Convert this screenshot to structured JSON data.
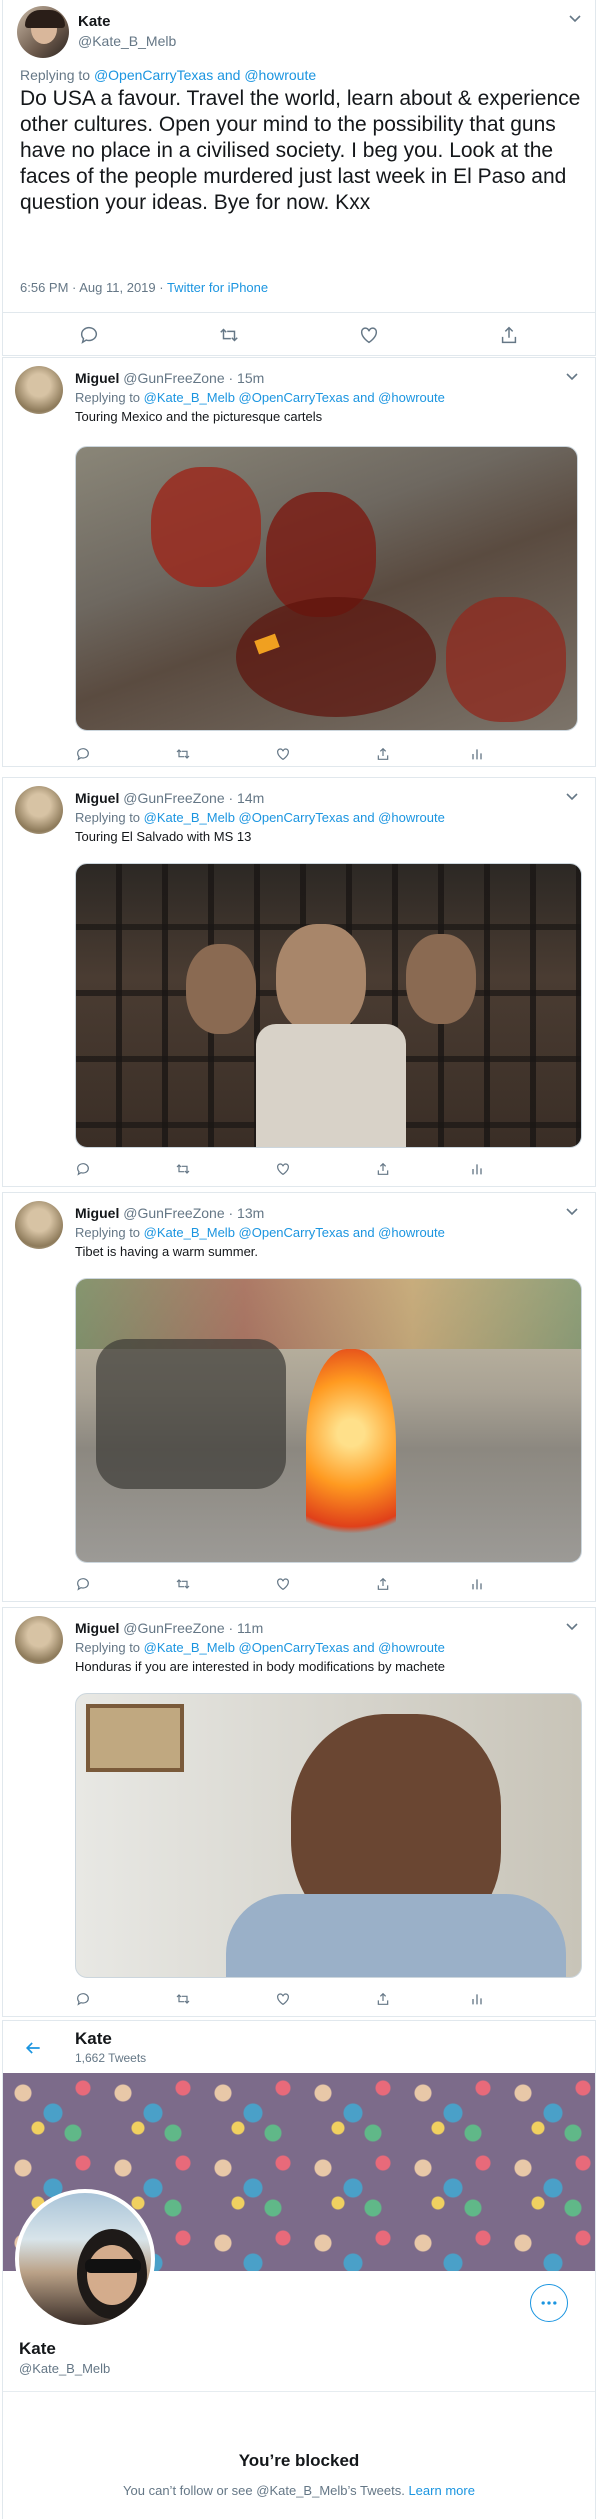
{
  "main_tweet": {
    "name": "Kate",
    "handle": "@Kate_B_Melb",
    "replying_label": "Replying to",
    "replying_to": "@OpenCarryTexas and @howroute",
    "text": "Do USA a favour. Travel the world, learn about & experience other cultures. Open your mind to the possibility that guns have no place in a civilised society. I beg you. Look at the faces of the people murdered just last week in El Paso and question your ideas. Bye for now. Kxx",
    "timestamp": "6:56 PM · Aug 11, 2019 · ",
    "source": "Twitter for iPhone"
  },
  "replies": [
    {
      "name": "Miguel",
      "handle_time": "@GunFreeZone · 15m",
      "replying_label": "Replying to",
      "replying_to": "@Kate_B_Melb @OpenCarryTexas and @howroute",
      "text": "Touring Mexico and the picturesque cartels"
    },
    {
      "name": "Miguel",
      "handle_time": "@GunFreeZone · 14m",
      "replying_label": "Replying to",
      "replying_to": "@Kate_B_Melb @OpenCarryTexas and @howroute",
      "text": "Touring El Salvado with MS 13"
    },
    {
      "name": "Miguel",
      "handle_time": "@GunFreeZone · 13m",
      "replying_label": "Replying to",
      "replying_to": "@Kate_B_Melb @OpenCarryTexas and @howroute",
      "text": "Tibet is having a warm summer."
    },
    {
      "name": "Miguel",
      "handle_time": "@GunFreeZone · 11m",
      "replying_label": "Replying to",
      "replying_to": "@Kate_B_Melb @OpenCarryTexas and @howroute",
      "text": "Honduras if you are interested in body modifications by machete"
    }
  ],
  "profile": {
    "header_name": "Kate",
    "tweet_count": "1,662 Tweets",
    "name": "Kate",
    "handle": "@Kate_B_Melb",
    "blocked_title": "You’re blocked",
    "blocked_text": "You can’t follow or see @Kate_B_Melb’s Tweets. ",
    "learn_more": "Learn more"
  },
  "colors": {
    "accent": "#1b95e0",
    "secondary_text": "#657786",
    "border": "#e1e8ed"
  },
  "icons": [
    "reply-icon",
    "retweet-icon",
    "like-icon",
    "share-icon",
    "analytics-icon",
    "chevron-down-icon",
    "back-arrow-icon",
    "more-icon"
  ]
}
